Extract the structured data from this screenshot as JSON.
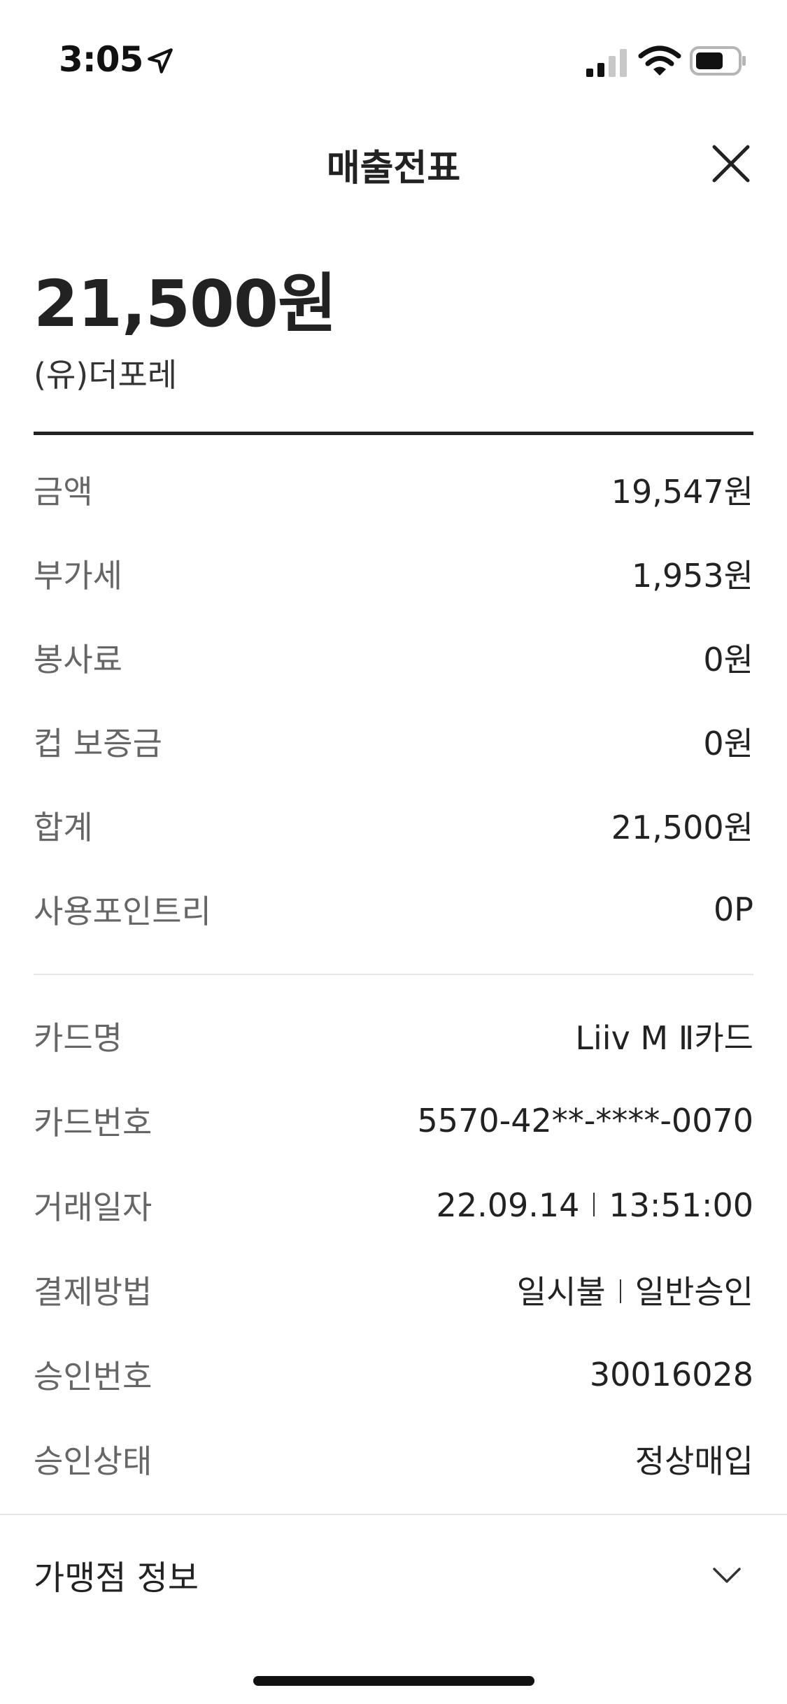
{
  "status_bar": {
    "time": "3:05",
    "icons": [
      "location-arrow-icon",
      "signal-icon",
      "wifi-icon",
      "battery-icon"
    ]
  },
  "header": {
    "title": "매출전표",
    "close_icon": "close-icon"
  },
  "summary": {
    "total_amount": "21,500원",
    "merchant": "(유)더포레"
  },
  "amount_rows": [
    {
      "label": "금액",
      "value": "19,547원"
    },
    {
      "label": "부가세",
      "value": "1,953원"
    },
    {
      "label": "봉사료",
      "value": "0원"
    },
    {
      "label": "컵 보증금",
      "value": "0원"
    },
    {
      "label": "합계",
      "value": "21,500원"
    },
    {
      "label": "사용포인트리",
      "value": "0P"
    }
  ],
  "card_rows": {
    "card_name": {
      "label": "카드명",
      "value": "Liiv M Ⅱ카드"
    },
    "card_number": {
      "label": "카드번호",
      "value": "5570-42**-****-0070"
    },
    "transaction_date": {
      "label": "거래일자",
      "date": "22.09.14",
      "time": "13:51:00"
    },
    "payment_method": {
      "label": "결제방법",
      "type": "일시불",
      "approval": "일반승인"
    },
    "approval_number": {
      "label": "승인번호",
      "value": "30016028"
    },
    "approval_status": {
      "label": "승인상태",
      "value": "정상매입"
    }
  },
  "merchant_info": {
    "label": "가맹점 정보",
    "icon": "chevron-down-icon"
  }
}
